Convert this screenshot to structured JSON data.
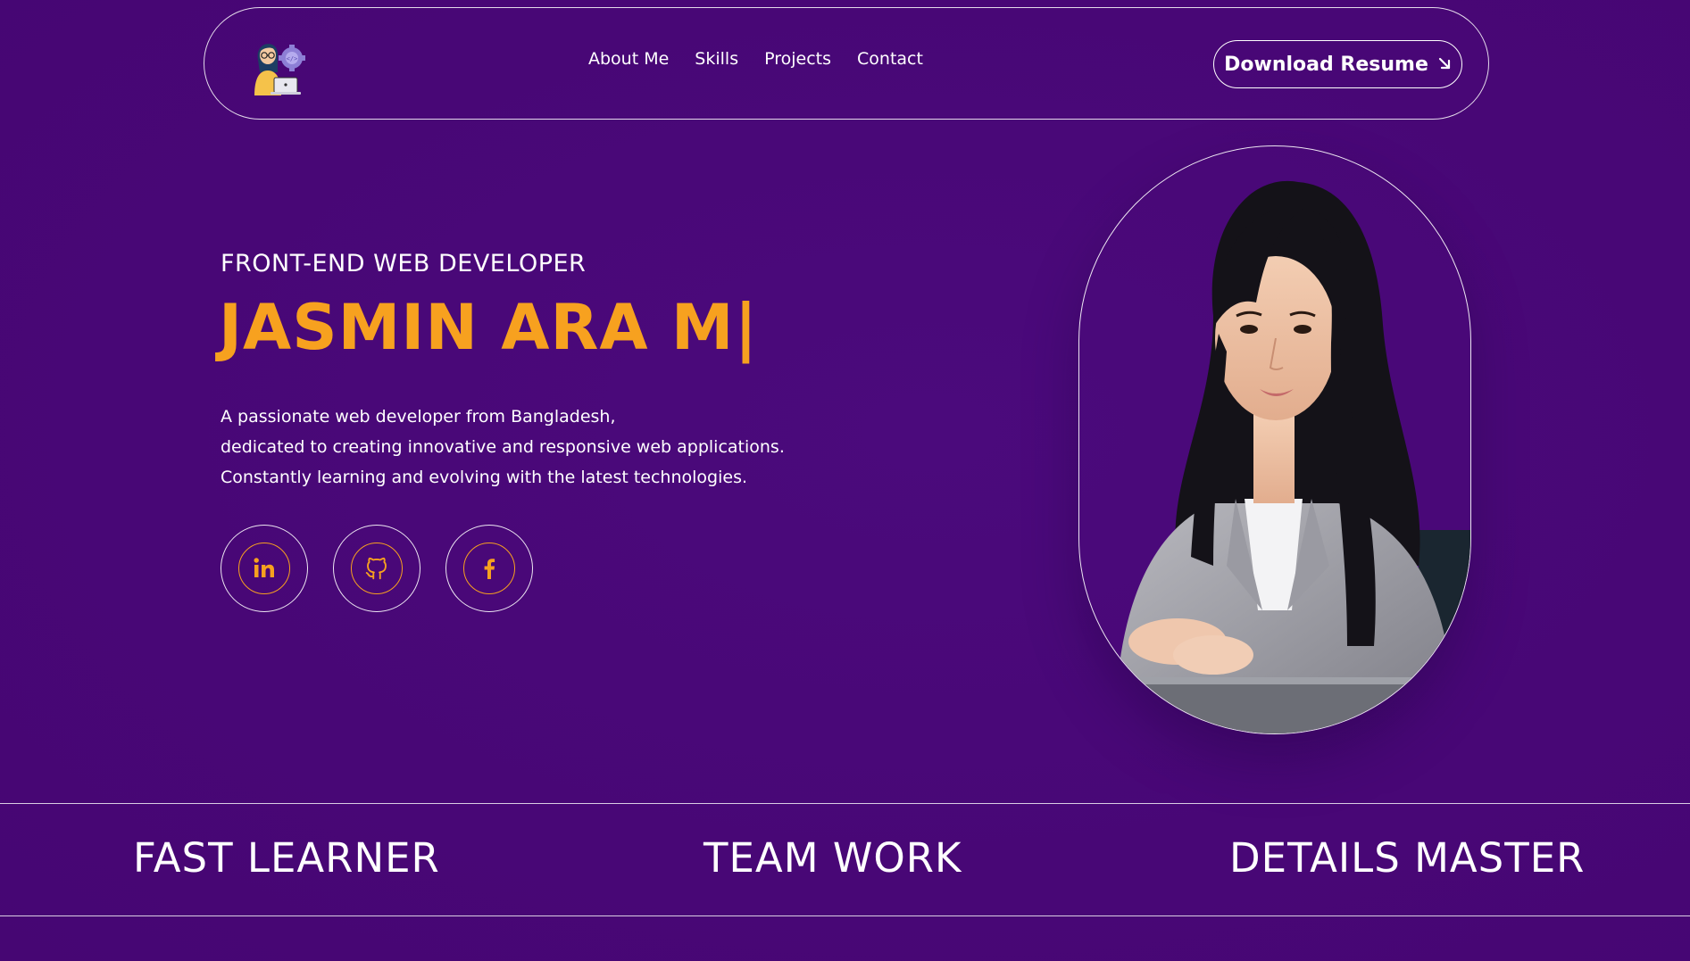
{
  "nav": {
    "logo_icon": "developer-avatar-icon",
    "links": [
      "About Me",
      "Skills",
      "Projects",
      "Contact"
    ],
    "resume_label": "Download Resume",
    "resume_icon": "arrow-down-right-icon"
  },
  "hero": {
    "subtitle": "FRONT-END WEB DEVELOPER",
    "name": "JASMIN ARA M|",
    "description": [
      "A passionate web developer from Bangladesh,",
      "dedicated to creating innovative and responsive web applications.",
      "Constantly learning and evolving with the latest technologies."
    ],
    "socials": [
      "linkedin-icon",
      "github-icon",
      "facebook-icon"
    ],
    "portrait": "profile-photo"
  },
  "strip": {
    "items": [
      "FAST LEARNER",
      "TEAM WORK",
      "DETAILS MASTER"
    ]
  },
  "colors": {
    "background": "#4a0877",
    "accent": "#f7a11f",
    "text": "#ffffff"
  }
}
